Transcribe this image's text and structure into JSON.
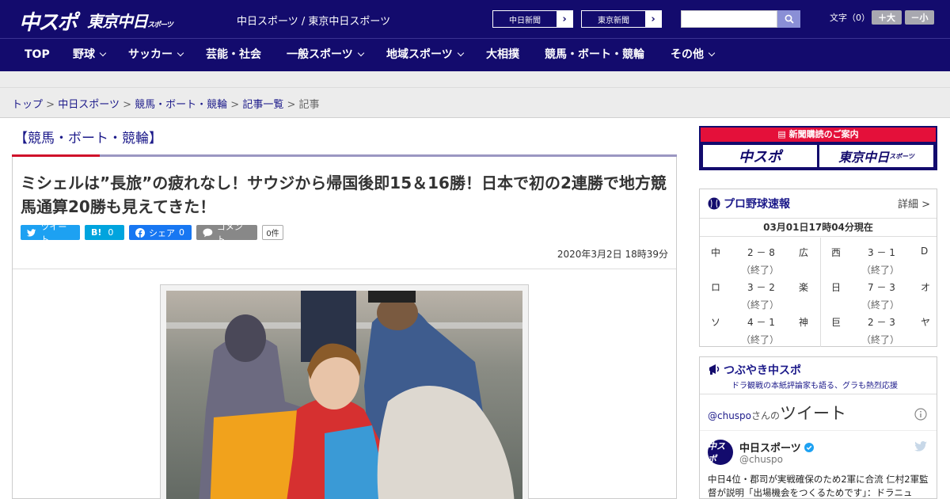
{
  "header": {
    "logo_chuspo": "中スポ",
    "logo_tokyo": "東京中日",
    "logo_tokyo_small": "スポーツ",
    "site_name": "中日スポーツ / 東京中日スポーツ",
    "paper1": "中日新聞",
    "paper2": "東京新聞",
    "search_placeholder": "",
    "font_size_label": "文字（0）",
    "font_larger": "＋大",
    "font_smaller": "－小"
  },
  "nav": [
    "TOP",
    "野球",
    "サッカー",
    "芸能・社会",
    "一般スポーツ",
    "地域スポーツ",
    "大相撲",
    "競馬・ボート・競輪",
    "その他"
  ],
  "breadcrumb": {
    "items": [
      "トップ",
      "中日スポーツ",
      "競馬・ボート・競輪",
      "記事一覧"
    ],
    "current": "記事",
    "sep": ">"
  },
  "article": {
    "category": "【競馬・ボート・競輪】",
    "headline": "ミシェルは”長旅”の疲れなし！サウジから帰国後即15＆16勝！日本で初の2連勝で地方競馬通算20勝も見えてきた！",
    "tweet_label": "ツイート",
    "hatena_label": "B!",
    "hatena_count": "0",
    "fb_label": "シェア",
    "fb_count": "0",
    "comment_label": "コメント",
    "comment_count": "0件",
    "date": "2020年3月2日 18時39分"
  },
  "subscription": {
    "title": "新聞購読のご案内",
    "logo1": "中スポ",
    "logo2": "東京中日",
    "logo2_small": "スポーツ"
  },
  "scores": {
    "title": "プロ野球速報",
    "detail": "詳細 >",
    "time": "03月01日17時04分現在",
    "left_games": [
      {
        "home": "中",
        "score": "2 － 8",
        "away": "広",
        "status": "（終了）"
      },
      {
        "home": "ロ",
        "score": "3 － 2",
        "away": "楽",
        "status": "（終了）"
      },
      {
        "home": "ソ",
        "score": "4 － 1",
        "away": "神",
        "status": "（終了）"
      }
    ],
    "right_games": [
      {
        "home": "西",
        "score": "3 － 1",
        "away": "D",
        "status": "（終了）"
      },
      {
        "home": "日",
        "score": "7 － 3",
        "away": "オ",
        "status": "（終了）"
      },
      {
        "home": "巨",
        "score": "2 － 3",
        "away": "ヤ",
        "status": "（終了）"
      }
    ]
  },
  "twitter": {
    "title": "つぶやき中スポ",
    "subtitle": "ドラ観戦の本紙評論家も語る、グラも熱烈応援",
    "handle_link": "@chuspo",
    "san": "さんの",
    "tweets_word": "ツイート",
    "name": "中日スポーツ",
    "handle": "@chuspo",
    "avatar_text": "中スポ",
    "text": "中日4位・郡司が実戦確保のため2軍に合流 仁村2軍監督が説明「出場機会をつくるためです」：ドラニュ"
  },
  "colors": {
    "brand_navy": "#130b6d",
    "accent_red": "#d0102a",
    "link_blue": "#1c1a8a",
    "twitter_blue": "#1da1f2",
    "hatena_blue": "#00a4de",
    "facebook_blue": "#1877f2"
  }
}
